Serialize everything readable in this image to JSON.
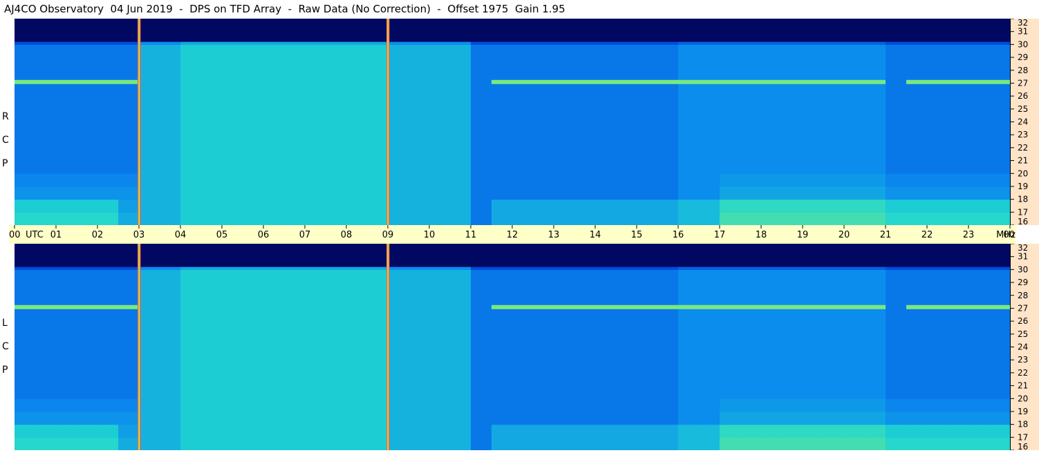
{
  "title": "AJ4CO Observatory  04 Jun 2019  -  DPS on TFD Array  -  Raw Data (No Correction)  -  Offset 1975  Gain 1.95",
  "panels": [
    {
      "id": "rcp",
      "label": [
        "R",
        "C",
        "P"
      ]
    },
    {
      "id": "lcp",
      "label": [
        "L",
        "C",
        "P"
      ]
    }
  ],
  "chart_data": {
    "type": "heatmap",
    "title": "AJ4CO Observatory  04 Jun 2019  -  DPS on TFD Array  -  Raw Data (No Correction)  -  Offset 1975  Gain 1.95",
    "x_axis": {
      "label": "UTC",
      "range_hours": [
        0,
        24
      ],
      "tick_labels": [
        "00",
        "01",
        "02",
        "03",
        "04",
        "05",
        "06",
        "07",
        "08",
        "09",
        "10",
        "11",
        "12",
        "13",
        "14",
        "15",
        "16",
        "17",
        "18",
        "19",
        "20",
        "21",
        "22",
        "23",
        "00"
      ]
    },
    "y_axis": {
      "label": "MHz",
      "range": [
        16,
        32
      ],
      "tick_labels": [
        "16",
        "17",
        "18",
        "19",
        "20",
        "21",
        "22",
        "23",
        "24",
        "25",
        "26",
        "27",
        "28",
        "29",
        "30",
        "31",
        "32"
      ]
    },
    "series": [
      {
        "name": "RCP"
      },
      {
        "name": "LCP"
      }
    ],
    "colormap": [
      "#00004a",
      "#002fd0",
      "#0a8aee",
      "#20d6d0",
      "#9cf060",
      "#ffe040",
      "#ff5030"
    ],
    "markers_utc_hours": [
      3,
      9
    ]
  }
}
